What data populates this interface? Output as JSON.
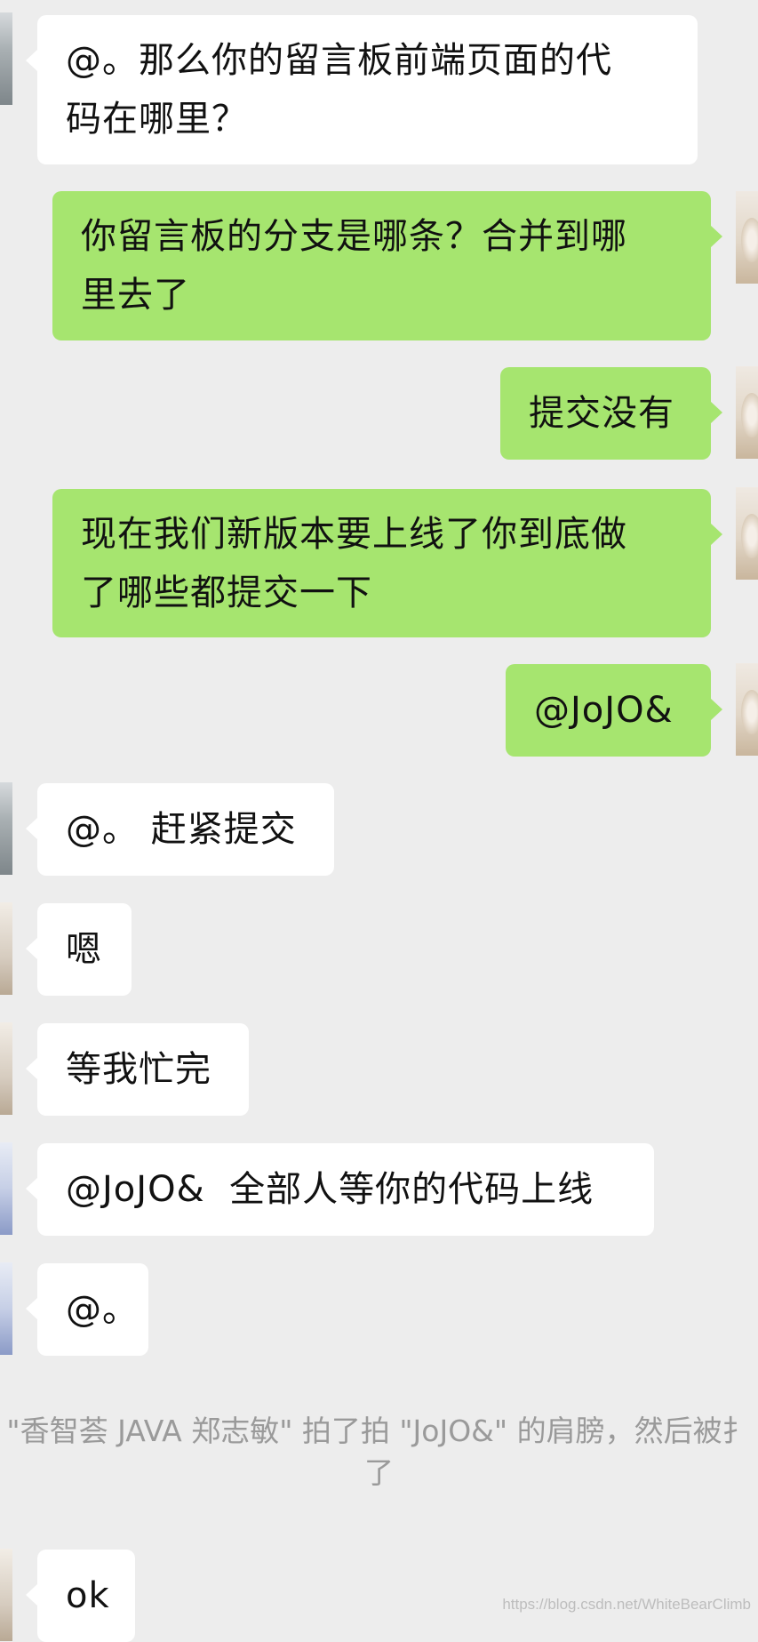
{
  "messages": [
    {
      "side": "left",
      "avatar": "city",
      "text": "@。那么你的留言板前端页面的代\n码在哪里？"
    },
    {
      "side": "right",
      "avatar": "person",
      "text": "你留言板的分支是哪条？合并到哪\n里去了"
    },
    {
      "side": "right",
      "avatar": "person",
      "text": "提交没有"
    },
    {
      "side": "right",
      "avatar": "person",
      "text": "现在我们新版本要上线了你到底做\n了哪些都提交一下"
    },
    {
      "side": "right",
      "avatar": "person",
      "text": "@JoJO&"
    },
    {
      "side": "left",
      "avatar": "city",
      "text": "@。 赶紧提交"
    },
    {
      "side": "left",
      "avatar": "hand",
      "text": "嗯"
    },
    {
      "side": "left",
      "avatar": "hand",
      "text": "等我忙完"
    },
    {
      "side": "left",
      "avatar": "blue",
      "text": "@JoJO&  全部人等你的代码上线"
    },
    {
      "side": "left",
      "avatar": "blue",
      "text": "@。"
    }
  ],
  "system_notice": {
    "line1": "\"香智荟 JAVA 郑志敏\" 拍了拍 \"JoJO&\" 的肩膀，然后被扌",
    "line2": "了"
  },
  "last_message": {
    "side": "left",
    "avatar": "hand",
    "text": "ok"
  },
  "watermark": "https://blog.csdn.net/WhiteBearClimb",
  "colors": {
    "background": "#ededed",
    "bubble_left": "#ffffff",
    "bubble_right": "#a6e56f",
    "system_text": "#9a9a9a"
  }
}
